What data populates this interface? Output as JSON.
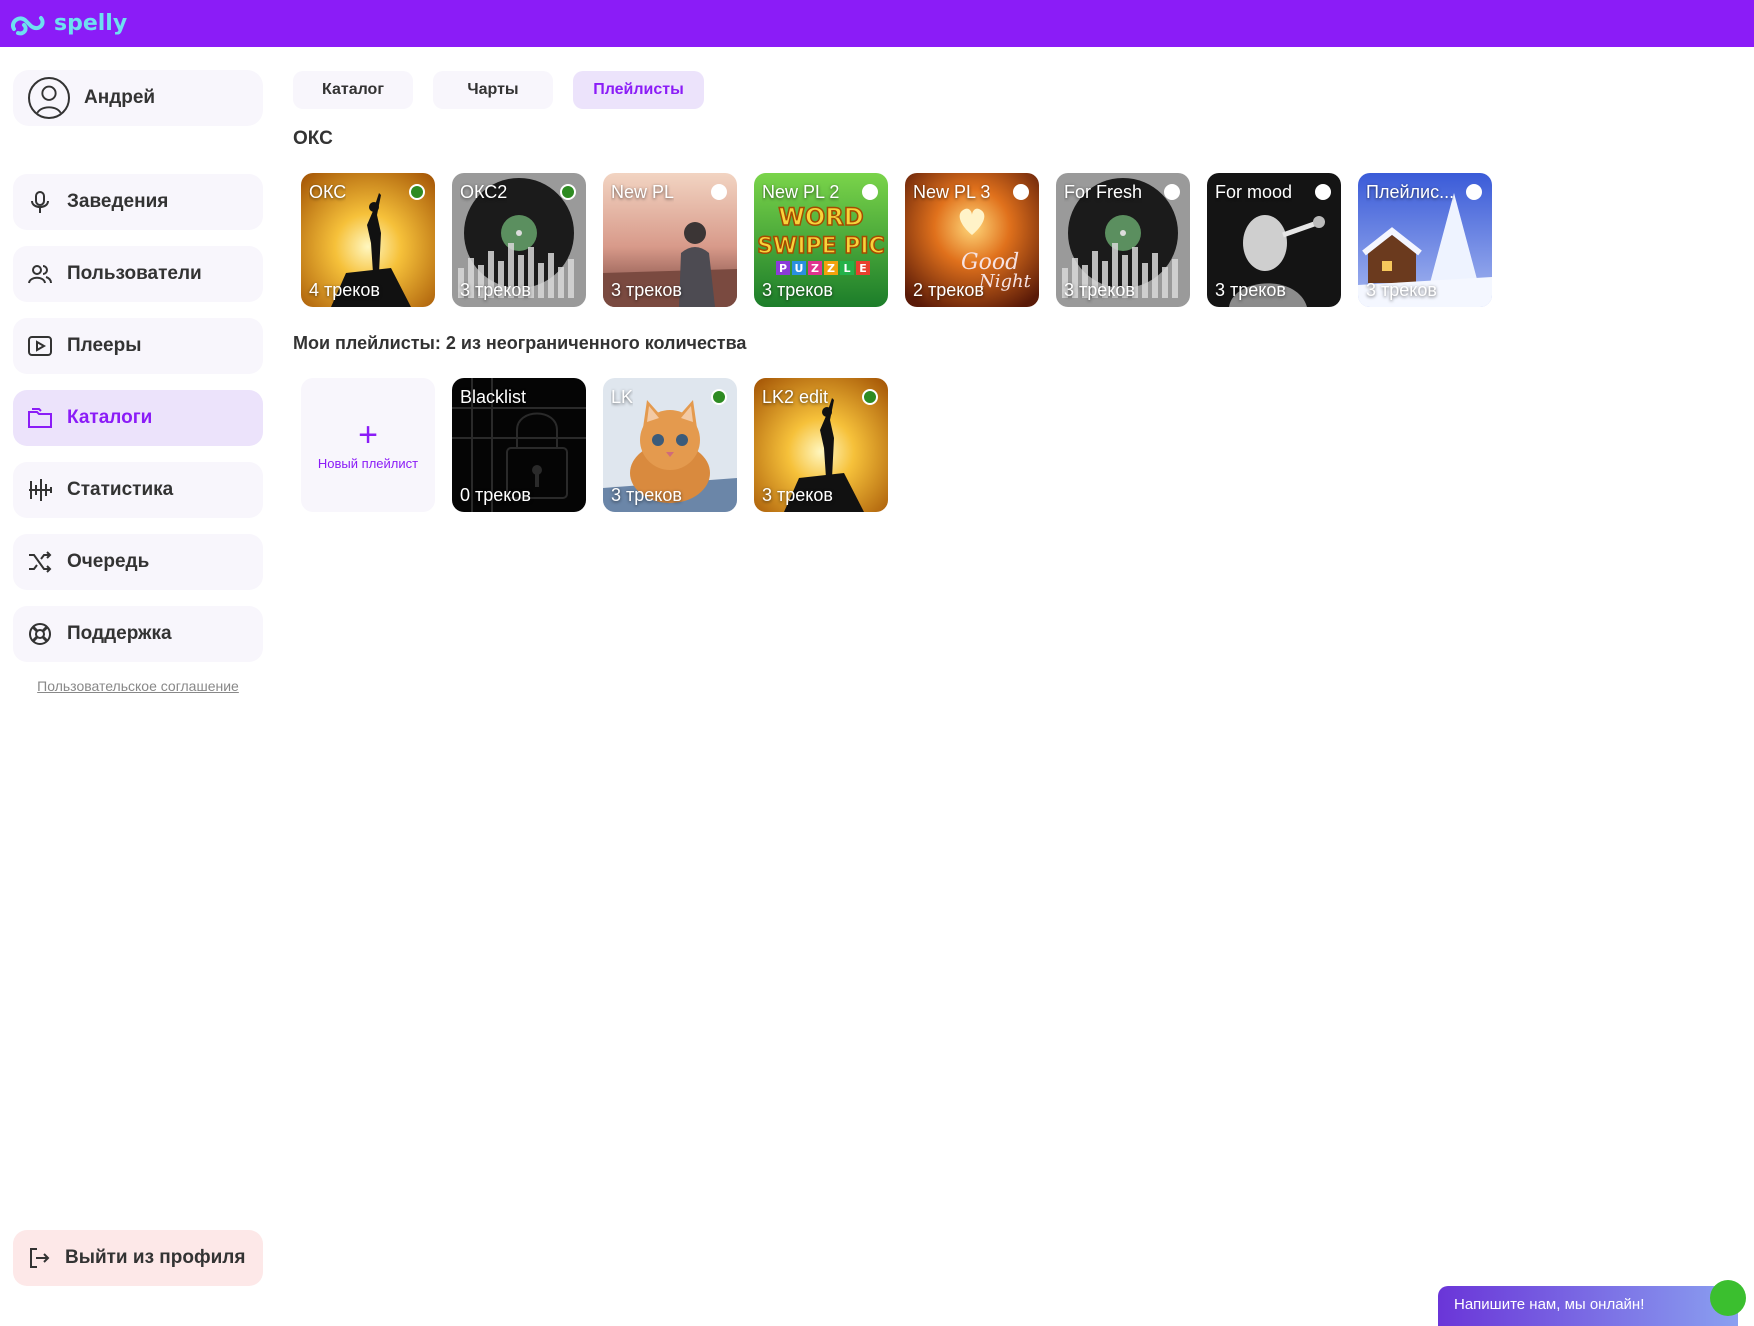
{
  "app": {
    "logo_text": "spelly",
    "brand_color": "#8b1cf7",
    "logo_color": "#6ee0f0"
  },
  "user": {
    "name": "Андрей",
    "icon": "user-avatar-icon"
  },
  "sidebar": {
    "items": [
      {
        "label": "Заведения",
        "icon": "mic-icon"
      },
      {
        "label": "Пользователи",
        "icon": "users-icon"
      },
      {
        "label": "Плееры",
        "icon": "play-icon"
      },
      {
        "label": "Каталоги",
        "icon": "folder-icon",
        "active": true
      },
      {
        "label": "Статистика",
        "icon": "stats-icon"
      },
      {
        "label": "Очередь",
        "icon": "shuffle-icon"
      },
      {
        "label": "Поддержка",
        "icon": "lifebuoy-icon"
      }
    ],
    "agreement": "Пользовательское соглашение",
    "logout": "Выйти из профиля"
  },
  "tabs": [
    {
      "label": "Каталог"
    },
    {
      "label": "Чарты"
    },
    {
      "label": "Плейлисты",
      "active": true
    }
  ],
  "section_okc": {
    "title": "ОКС",
    "playlists": [
      {
        "title": "ОКС",
        "count": "4 треков",
        "active": true,
        "theme": "sunset-man"
      },
      {
        "title": "ОКС2",
        "count": "3 треков",
        "active": true,
        "theme": "vinyl"
      },
      {
        "title": "New PL",
        "count": "3 треков",
        "active": false,
        "theme": "city-dusk"
      },
      {
        "title": "New PL 2",
        "count": "3 треков",
        "active": false,
        "theme": "word-swipe"
      },
      {
        "title": "New PL 3",
        "count": "2 треков",
        "active": false,
        "theme": "good-night"
      },
      {
        "title": "For Fresh",
        "count": "3 треков",
        "active": false,
        "theme": "vinyl"
      },
      {
        "title": "For mood",
        "count": "3 треков",
        "active": false,
        "theme": "singer"
      },
      {
        "title": "Плейлис...",
        "count": "3 треков",
        "active": false,
        "theme": "winter"
      }
    ]
  },
  "section_mine": {
    "title": "Мои плейлисты: 2 из неограниченного количества",
    "new_label": "Новый плейлист",
    "playlists": [
      {
        "title": "Blacklist",
        "count": "0 треков",
        "active": null,
        "theme": "lock"
      },
      {
        "title": "LK",
        "count": "3 треков",
        "active": true,
        "theme": "kitten"
      },
      {
        "title": "LK2 edit",
        "count": "3 треков",
        "active": true,
        "theme": "sunset-man"
      }
    ]
  },
  "chat": {
    "label": "Напишите нам, мы онлайн!"
  }
}
